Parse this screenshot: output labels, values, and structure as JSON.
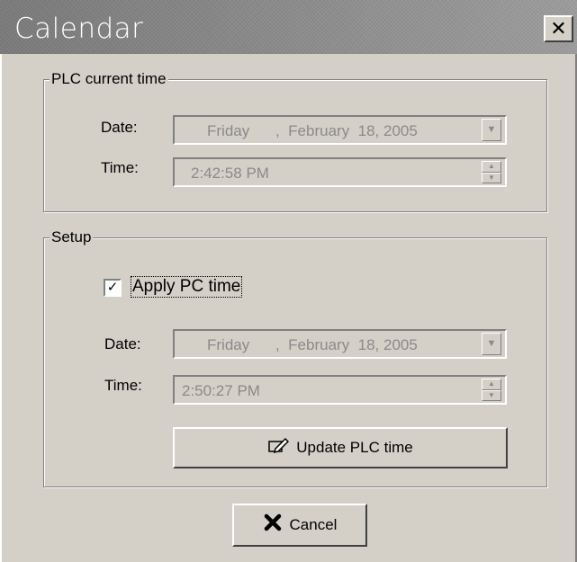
{
  "window": {
    "title": "Calendar",
    "close_symbol": "✕"
  },
  "plc_group": {
    "label": "PLC current time",
    "date_label": "Date:",
    "date_weekday": "Friday",
    "date_rest": ",  February  18, 2005",
    "time_label": "Time:",
    "time_value": "2:42:58 PM"
  },
  "setup_group": {
    "label": "Setup",
    "apply_pc_time_label": "Apply PC time",
    "apply_pc_time_checked": true,
    "date_label": "Date:",
    "date_weekday": "Friday",
    "date_rest": ",  February  18, 2005",
    "time_label": "Time:",
    "time_value": "2:50:27 PM",
    "update_button_label": "Update PLC time"
  },
  "cancel_button_label": "Cancel",
  "icons": {
    "dropdown": "chevron-down-icon",
    "spin_up": "spin-up-icon",
    "spin_down": "spin-down-icon",
    "update": "pencil-icon",
    "cancel": "x-icon",
    "close": "close-icon"
  }
}
